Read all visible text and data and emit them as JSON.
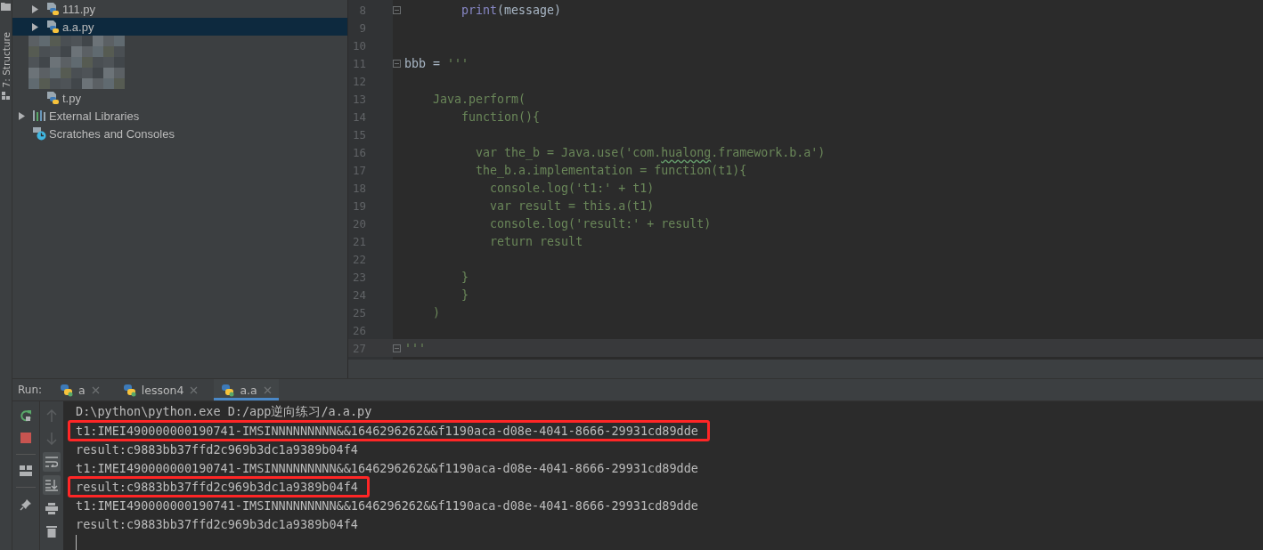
{
  "tool_strip": {
    "label": "7: Structure"
  },
  "project_tree": {
    "items": [
      {
        "children": [
          {
            "label": "111.py",
            "kind": "python-file",
            "expanded": false,
            "selected": false
          },
          {
            "label": "a.a.py",
            "kind": "python-file",
            "expanded": false,
            "selected": true
          },
          {
            "kind": "redacted"
          },
          {
            "label": "t.py",
            "kind": "python-file",
            "selected": false
          }
        ]
      },
      {
        "label": "External Libraries",
        "kind": "libraries",
        "expanded": false,
        "selected": false
      },
      {
        "label": "Scratches and Consoles",
        "kind": "scratches",
        "selected": false
      }
    ]
  },
  "editor": {
    "lines": [
      {
        "number": "8",
        "fold_marker": true,
        "tokens": [
          {
            "text": "        print",
            "kind": "builtin"
          },
          {
            "text": "(message)",
            "kind": "plain"
          }
        ]
      },
      {
        "number": "9"
      },
      {
        "number": "10"
      },
      {
        "number": "11",
        "fold_marker": true,
        "tokens": [
          {
            "text": "bbb = ",
            "kind": "plain"
          },
          {
            "text": "'''",
            "kind": "string"
          }
        ]
      },
      {
        "number": "12"
      },
      {
        "number": "13",
        "tokens": [
          {
            "text": "    Java.perform(",
            "kind": "string"
          }
        ]
      },
      {
        "number": "14",
        "tokens": [
          {
            "text": "        function(){",
            "kind": "string"
          }
        ]
      },
      {
        "number": "15"
      },
      {
        "number": "16",
        "tokens": [
          {
            "text": "          var the_b = Java.use('com.",
            "kind": "string"
          },
          {
            "text": "hualong",
            "kind": "string",
            "typo": true
          },
          {
            "text": ".framework.b.a')",
            "kind": "string"
          }
        ]
      },
      {
        "number": "17",
        "tokens": [
          {
            "text": "          the_b.a.implementation = function(t1){",
            "kind": "string"
          }
        ]
      },
      {
        "number": "18",
        "tokens": [
          {
            "text": "            console.log('t1:' + t1)",
            "kind": "string"
          }
        ]
      },
      {
        "number": "19",
        "tokens": [
          {
            "text": "            var result = this.a(t1)",
            "kind": "string"
          }
        ]
      },
      {
        "number": "20",
        "tokens": [
          {
            "text": "            console.log('result:' + result)",
            "kind": "string"
          }
        ]
      },
      {
        "number": "21",
        "tokens": [
          {
            "text": "            return result",
            "kind": "string"
          }
        ]
      },
      {
        "number": "22"
      },
      {
        "number": "23",
        "tokens": [
          {
            "text": "        }",
            "kind": "string"
          }
        ]
      },
      {
        "number": "24",
        "tokens": [
          {
            "text": "        }",
            "kind": "string"
          }
        ]
      },
      {
        "number": "25",
        "tokens": [
          {
            "text": "    )",
            "kind": "string"
          }
        ]
      },
      {
        "number": "26"
      },
      {
        "number": "27",
        "fold_marker": true,
        "current": true,
        "tokens": [
          {
            "text": "'''",
            "kind": "string"
          }
        ]
      }
    ]
  },
  "run_panel": {
    "label": "Run:",
    "tabs": [
      {
        "label": "a",
        "selected": false
      },
      {
        "label": "lesson4",
        "selected": false
      },
      {
        "label": "a.a",
        "selected": true
      }
    ],
    "side_tools": [
      {
        "disabled": true,
        "on": false
      },
      {
        "disabled": true,
        "on": false
      },
      {
        "disabled": false,
        "on": true
      },
      {
        "disabled": false,
        "on": true
      },
      {
        "disabled": false,
        "on": false
      },
      {
        "disabled": false,
        "on": false
      }
    ],
    "console": [
      {
        "text": "D:\\python\\python.exe D:/app逆向练习/a.a.py",
        "boxed": false
      },
      {
        "text": "t1:IMEI490000000190741-IMSINNNNNNNNN&&1646296262&&f1190aca-d08e-4041-8666-29931cd89dde",
        "boxed": true
      },
      {
        "text": "result:c9883bb37ffd2c969b3dc1a9389b04f4",
        "boxed": false
      },
      {
        "text": "t1:IMEI490000000190741-IMSINNNNNNNNN&&1646296262&&f1190aca-d08e-4041-8666-29931cd89dde",
        "boxed": false
      },
      {
        "text": "result:c9883bb37ffd2c969b3dc1a9389b04f4",
        "boxed": true
      },
      {
        "text": "t1:IMEI490000000190741-IMSINNNNNNNNN&&1646296262&&f1190aca-d08e-4041-8666-29931cd89dde",
        "boxed": false
      },
      {
        "text": "result:c9883bb37ffd2c969b3dc1a9389b04f4",
        "boxed": false
      }
    ]
  }
}
